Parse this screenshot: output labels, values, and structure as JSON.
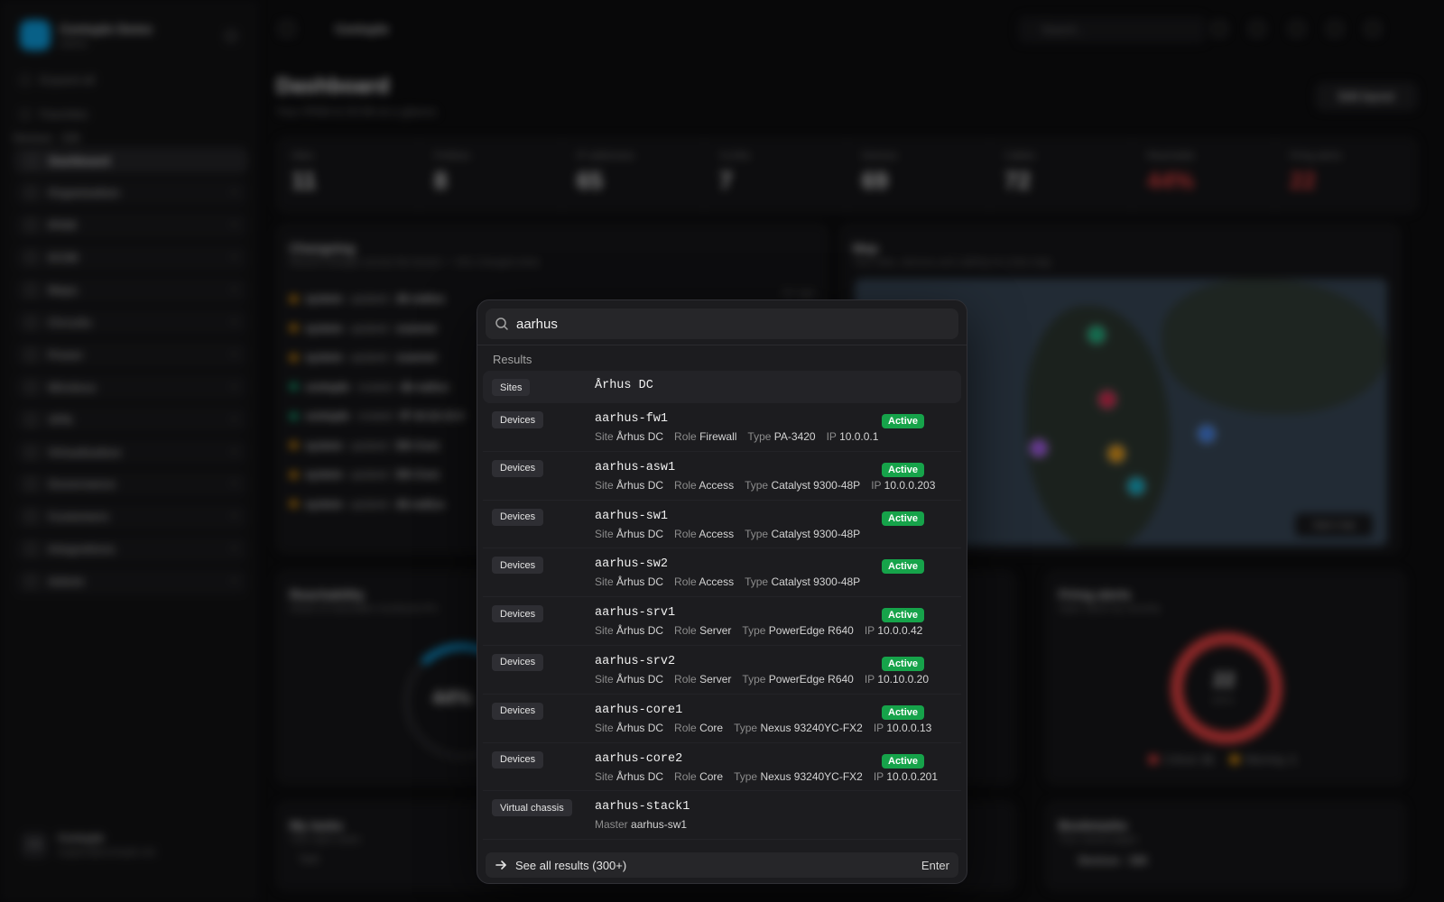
{
  "app": {
    "org_name": "Centuple Demo",
    "org_sub": "Admin",
    "expand_all": "Expand all",
    "favorites": "Favorites",
    "section_label": "Devices · 326",
    "nav_items": [
      {
        "label": "Dashboard"
      },
      {
        "label": "Organization"
      },
      {
        "label": "IPAM"
      },
      {
        "label": "DCIM"
      },
      {
        "label": "Maps"
      },
      {
        "label": "Circuits"
      },
      {
        "label": "Power"
      },
      {
        "label": "Wireless"
      },
      {
        "label": "VPN"
      },
      {
        "label": "Virtualization"
      },
      {
        "label": "Governance"
      },
      {
        "label": "Customers"
      },
      {
        "label": "Integrations"
      },
      {
        "label": "Admin"
      }
    ],
    "user": {
      "initials": "CN",
      "name": "Centuple",
      "email": "support@centuple.net"
    }
  },
  "topbar": {
    "breadcrumb": "Centuple",
    "search_placeholder": "Search..."
  },
  "dashboard": {
    "title": "Dashboard",
    "subtitle": "Your IPAM & DCIM at a glance.",
    "edit_layout": "Edit layout",
    "stats": [
      {
        "label": "Sites",
        "value": "11"
      },
      {
        "label": "Prefixes",
        "value": "8"
      },
      {
        "label": "IP addresses",
        "value": "65"
      },
      {
        "label": "VLANs",
        "value": "7"
      },
      {
        "label": "Devices",
        "value": "69"
      },
      {
        "label": "Cables",
        "value": "72"
      },
      {
        "label": "Reachable",
        "value": "44%",
        "alert": true
      },
      {
        "label": "Firing alerts",
        "value": "22",
        "alert": true
      }
    ],
    "changelog_title": "Changelog",
    "changelog_sub": "Recent changes across the tenant — who changed what",
    "changelog_time": "2m ago",
    "changelog": [
      {
        "actor": "system",
        "action": "updated",
        "target": "dk-radius",
        "color": "#f59e0b"
      },
      {
        "actor": "system",
        "action": "updated",
        "target": "scanner",
        "color": "#f59e0b"
      },
      {
        "actor": "system",
        "action": "updated",
        "target": "scanner",
        "color": "#f59e0b"
      },
      {
        "actor": "centuple",
        "action": "created",
        "target": "dk-radius",
        "color": "#10b981"
      },
      {
        "actor": "centuple",
        "action": "created",
        "target": "IP 10.10.10.0",
        "color": "#10b981"
      },
      {
        "actor": "system",
        "action": "updated",
        "target": "DK-Core",
        "color": "#f59e0b"
      },
      {
        "actor": "system",
        "action": "updated",
        "target": "DK-Core",
        "color": "#f59e0b"
      },
      {
        "actor": "system",
        "action": "updated",
        "target": "dk-radius",
        "color": "#f59e0b"
      }
    ],
    "map_title": "Map",
    "map_sub": "Your sites, devices and cabling on a live map",
    "map_button": "Open map",
    "reach_title": "Reachability",
    "reach_sub": "Share of reachable monitored IPs",
    "reach_value": "44%",
    "alerts_title": "Firing alerts",
    "alerts_sub": "Open alerts by severity",
    "alerts_value": "22",
    "alerts_unit": "alerts",
    "alerts_legend": [
      {
        "label": "Critical",
        "value": "21",
        "color": "#ef4444"
      },
      {
        "label": "Warning",
        "value": "1",
        "color": "#f59e0b"
      }
    ],
    "tasks_title": "My tasks",
    "tasks_sub": "Your open tasks",
    "tasks_col": "Task",
    "bookmarks_title": "Bookmarks",
    "bookmarks_sub": "Your saved pages",
    "bookmarks_item": "Devices · 326"
  },
  "palette": {
    "query": "aarhus",
    "results_heading": "Results",
    "results": [
      {
        "type": "Sites",
        "name": "Århus DC",
        "meta": []
      },
      {
        "type": "Devices",
        "name": "aarhus-fw1",
        "status": "Active",
        "meta": [
          [
            "Site",
            "Århus DC"
          ],
          [
            "Role",
            "Firewall"
          ],
          [
            "Type",
            "PA-3420"
          ],
          [
            "IP",
            "10.0.0.1"
          ]
        ]
      },
      {
        "type": "Devices",
        "name": "aarhus-asw1",
        "status": "Active",
        "meta": [
          [
            "Site",
            "Århus DC"
          ],
          [
            "Role",
            "Access"
          ],
          [
            "Type",
            "Catalyst 9300-48P"
          ],
          [
            "IP",
            "10.0.0.203"
          ]
        ]
      },
      {
        "type": "Devices",
        "name": "aarhus-sw1",
        "status": "Active",
        "meta": [
          [
            "Site",
            "Århus DC"
          ],
          [
            "Role",
            "Access"
          ],
          [
            "Type",
            "Catalyst 9300-48P"
          ]
        ]
      },
      {
        "type": "Devices",
        "name": "aarhus-sw2",
        "status": "Active",
        "meta": [
          [
            "Site",
            "Århus DC"
          ],
          [
            "Role",
            "Access"
          ],
          [
            "Type",
            "Catalyst 9300-48P"
          ]
        ]
      },
      {
        "type": "Devices",
        "name": "aarhus-srv1",
        "status": "Active",
        "meta": [
          [
            "Site",
            "Århus DC"
          ],
          [
            "Role",
            "Server"
          ],
          [
            "Type",
            "PowerEdge R640"
          ],
          [
            "IP",
            "10.0.0.42"
          ]
        ]
      },
      {
        "type": "Devices",
        "name": "aarhus-srv2",
        "status": "Active",
        "meta": [
          [
            "Site",
            "Århus DC"
          ],
          [
            "Role",
            "Server"
          ],
          [
            "Type",
            "PowerEdge R640"
          ],
          [
            "IP",
            "10.10.0.20"
          ]
        ]
      },
      {
        "type": "Devices",
        "name": "aarhus-core1",
        "status": "Active",
        "meta": [
          [
            "Site",
            "Århus DC"
          ],
          [
            "Role",
            "Core"
          ],
          [
            "Type",
            "Nexus 93240YC-FX2"
          ],
          [
            "IP",
            "10.0.0.13"
          ]
        ]
      },
      {
        "type": "Devices",
        "name": "aarhus-core2",
        "status": "Active",
        "meta": [
          [
            "Site",
            "Århus DC"
          ],
          [
            "Role",
            "Core"
          ],
          [
            "Type",
            "Nexus 93240YC-FX2"
          ],
          [
            "IP",
            "10.0.0.201"
          ]
        ]
      },
      {
        "type": "Virtual chassis",
        "name": "aarhus-stack1",
        "meta": [
          [
            "Master",
            "aarhus-sw1"
          ]
        ]
      }
    ],
    "see_all": "See all results (300+)",
    "enter_hint": "Enter",
    "colors": {
      "active_badge": "#16a34a",
      "accent": "#0ea5e9"
    }
  }
}
